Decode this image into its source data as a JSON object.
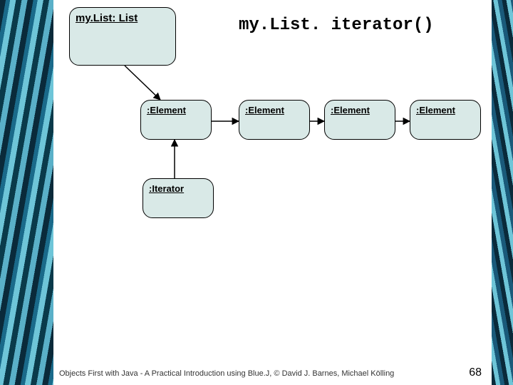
{
  "title": "my.List. iterator()",
  "list_node": "my.List: List",
  "elements": [
    ":Element",
    ":Element",
    ":Element",
    ":Element"
  ],
  "iterator_node": ":Iterator",
  "footer": "Objects First with Java - A Practical Introduction using Blue.J, © David J. Barnes, Michael Kölling",
  "page_number": "68"
}
